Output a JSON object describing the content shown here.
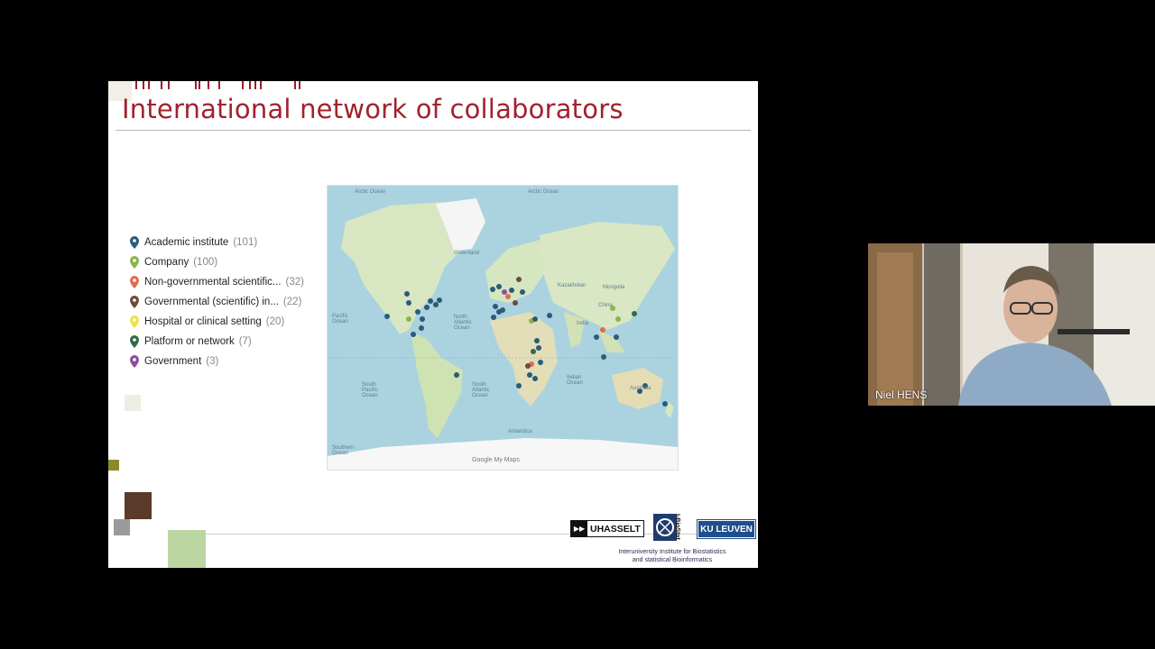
{
  "slide": {
    "title": "International network of collaborators",
    "legend": [
      {
        "label": "Academic institute",
        "count": "(101)",
        "color": "#2b5a7a"
      },
      {
        "label": "Company",
        "count": "(100)",
        "color": "#8db44a"
      },
      {
        "label": "Non-governmental scientific...",
        "count": "(32)",
        "color": "#e06c55"
      },
      {
        "label": "Governmental (scientific) in...",
        "count": "(22)",
        "color": "#6e4b3a"
      },
      {
        "label": "Hospital or clinical setting",
        "count": "(20)",
        "color": "#f2e04a"
      },
      {
        "label": "Platform or network",
        "count": "(7)",
        "color": "#2f6b43"
      },
      {
        "label": "Government",
        "count": "(3)",
        "color": "#8e4ea0"
      }
    ],
    "map": {
      "labels": {
        "arctic_ocean_left": "Arctic Ocean",
        "arctic_ocean_right": "Arctic Ocean",
        "greenland": "Greenland",
        "pacific_ocean": "Pacific Ocean",
        "north_atlantic_ocean": "North Atlantic Ocean",
        "south_pacific_ocean": "South Pacific Ocean",
        "south_atlantic_ocean": "South Atlantic Ocean",
        "indian_ocean": "Indian Ocean",
        "southern_ocean": "Southern Ocean",
        "antarctica": "Antarctica",
        "australia": "Australia",
        "kazakhstan": "Kazakhstan",
        "china": "China",
        "india": "India",
        "mongolia": "Mongolia"
      },
      "footer": "Google My Maps"
    },
    "logos": {
      "uhasselt": "UHASSELT",
      "ibiostat": "I-BioStat",
      "kuleuven": "KU LEUVEN",
      "institute_line1": "Interuniversity Institute for Biostatistics",
      "institute_line2": "and statistical Bioinformatics"
    }
  },
  "participant": {
    "name": "Niel HENS"
  }
}
